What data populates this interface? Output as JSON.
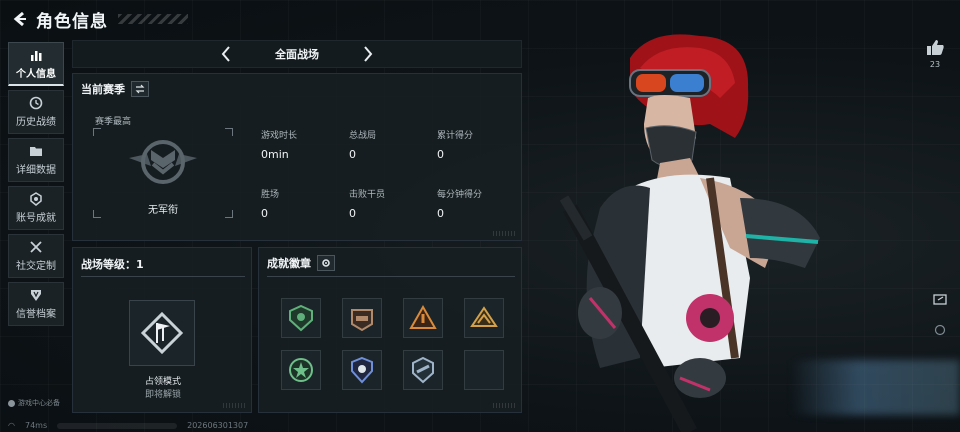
{
  "header": {
    "title": "角色信息"
  },
  "nav": {
    "items": [
      {
        "label": "个人信息",
        "icon": "bar-chart-icon",
        "active": true
      },
      {
        "label": "历史战绩",
        "icon": "history-clock-icon",
        "active": false
      },
      {
        "label": "详细数据",
        "icon": "folder-icon",
        "active": false
      },
      {
        "label": "账号成就",
        "icon": "achievement-medal-icon",
        "active": false
      },
      {
        "label": "社交定制",
        "icon": "tools-icon",
        "active": false
      },
      {
        "label": "信誉档案",
        "icon": "shield-icon",
        "active": false
      }
    ]
  },
  "mode": {
    "current": "全面战场"
  },
  "season": {
    "title": "当前赛季",
    "highest_label": "赛季最高",
    "rank_name": "无军衔",
    "stats": [
      {
        "label": "游戏时长",
        "value": "0min"
      },
      {
        "label": "总战局",
        "value": "0"
      },
      {
        "label": "累计得分",
        "value": "0"
      },
      {
        "label": "胜场",
        "value": "0"
      },
      {
        "label": "击败干员",
        "value": "0"
      },
      {
        "label": "每分钟得分",
        "value": "0"
      }
    ]
  },
  "battle_level": {
    "title": "战场等级：1",
    "mode_name": "占领模式",
    "mode_status": "即将解锁"
  },
  "badges": {
    "title": "成就徽章",
    "slots": [
      {
        "icon": "green-shield-badge-icon",
        "color": "#5fb07a"
      },
      {
        "icon": "bronze-vehicle-badge-icon",
        "color": "#b08a6a"
      },
      {
        "icon": "orange-triangle-badge-icon",
        "color": "#d98a3a"
      },
      {
        "icon": "gold-triangle-badge-icon",
        "color": "#d4a14a"
      },
      {
        "icon": "green-star-badge-icon",
        "color": "#6fbf8a"
      },
      {
        "icon": "blue-shield-badge-icon",
        "color": "#6f8fd9"
      },
      {
        "icon": "silver-wing-badge-icon",
        "color": "#9fb4c9"
      },
      {
        "icon": "empty-slot",
        "color": ""
      }
    ]
  },
  "like": {
    "count": "23"
  },
  "footer": {
    "brand": "游戏中心必备",
    "ping": "74ms",
    "player_id": "202606301307"
  },
  "colors": {
    "accent": "#f2f5f7",
    "panel": "#171e22",
    "hair": "#b0141c"
  }
}
